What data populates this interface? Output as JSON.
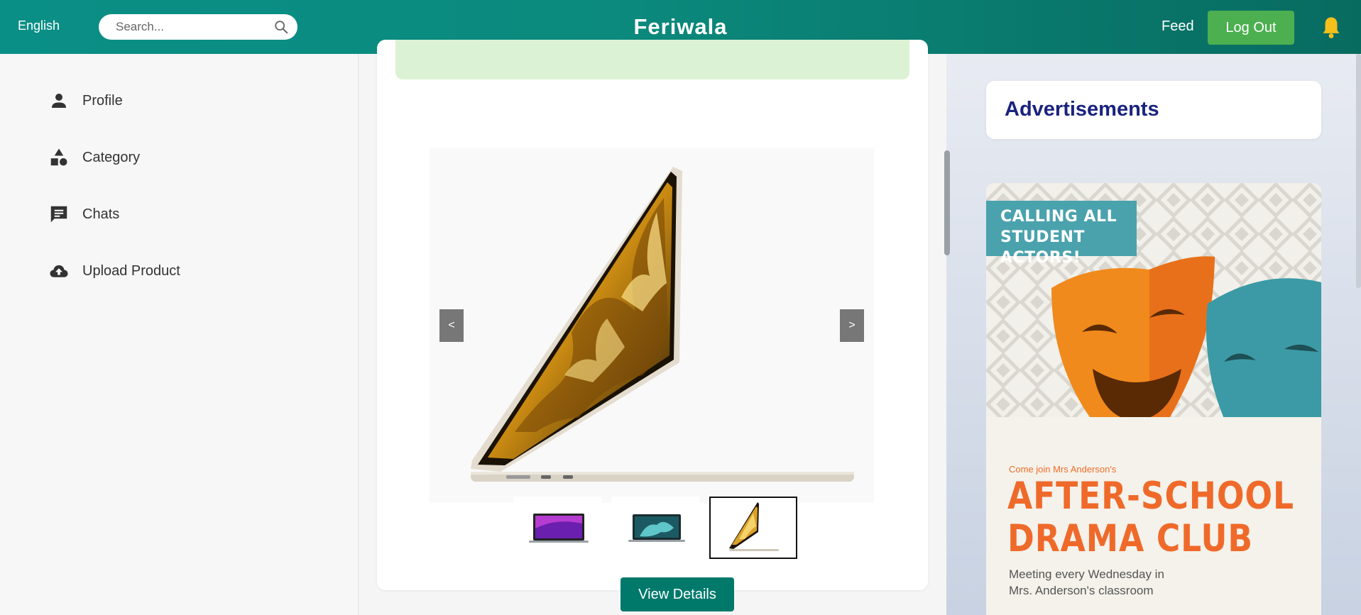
{
  "header": {
    "language": "English",
    "search_placeholder": "Search...",
    "brand": "Feriwala",
    "feed_label": "Feed",
    "logout_label": "Log Out"
  },
  "sidebar": {
    "items": [
      {
        "label": "Profile",
        "icon": "person-icon"
      },
      {
        "label": "Category",
        "icon": "shapes-icon"
      },
      {
        "label": "Chats",
        "icon": "chat-icon"
      },
      {
        "label": "Upload Product",
        "icon": "cloud-upload-icon"
      }
    ]
  },
  "product": {
    "prev_label": "<",
    "next_label": ">",
    "thumbnails": [
      {
        "name": "laptop-purple-thumb",
        "selected": false
      },
      {
        "name": "laptop-teal-thumb",
        "selected": false
      },
      {
        "name": "laptop-gold-thumb",
        "selected": true
      }
    ],
    "view_details_label": "View Details"
  },
  "ads": {
    "heading": "Advertisements",
    "poster": {
      "call_line1": "CALLING ALL",
      "call_line2": "STUDENT ACTORS!",
      "come_join": "Come join Mrs Anderson's",
      "title_line1": "AFTER-SCHOOL",
      "title_line2": "DRAMA CLUB",
      "meeting_line1": "Meeting every Wednesday in",
      "meeting_line2": "Mrs. Anderson's classroom"
    }
  },
  "colors": {
    "header_teal": "#0a8f86",
    "logout_green": "#4caf50",
    "view_button": "#00796b",
    "ad_heading": "#1a237e",
    "poster_orange": "#ef6a2a",
    "poster_teal": "#4aa2ad"
  }
}
